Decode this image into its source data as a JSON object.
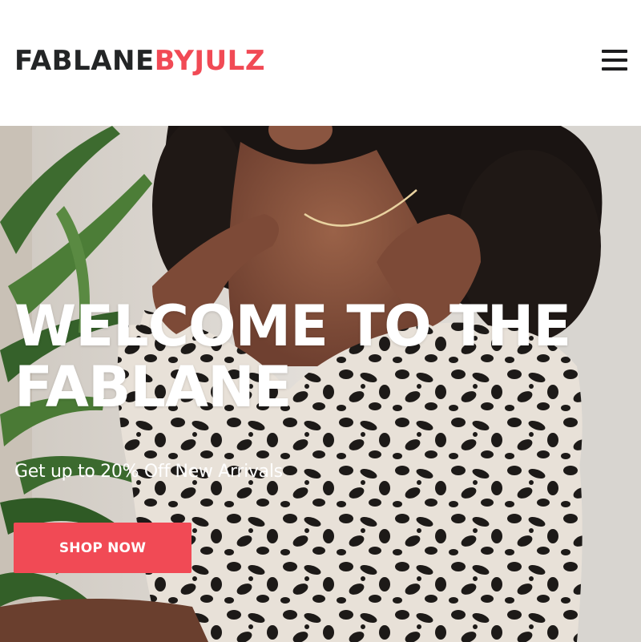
{
  "header": {
    "logo_part_a": "FABLANE",
    "logo_part_b": "BYJULZ",
    "menu_icon": "hamburger-menu-icon"
  },
  "hero": {
    "title_line_1": "WELCOME TO THE",
    "title_line_2": "FABLANE",
    "subtitle": "Get up to 20% Off New Arrivals",
    "cta_label": "SHOP NOW",
    "image": "woman-in-leopard-print-dress-photo"
  },
  "colors": {
    "accent": "#f14a55",
    "logo_dark": "#232526",
    "hero_text": "#ffffff"
  }
}
